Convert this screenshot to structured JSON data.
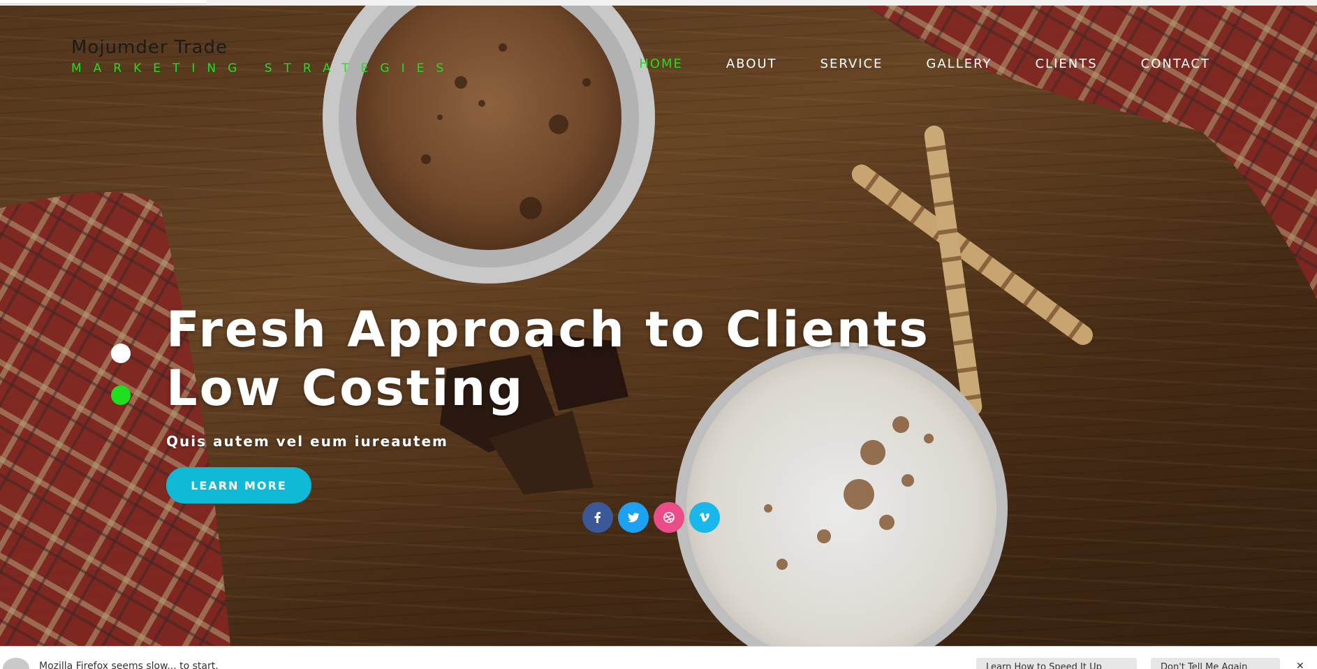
{
  "brand": {
    "name": "Mojumder Trade",
    "tagline": "MARKETING STRATEGIES"
  },
  "nav": {
    "items": [
      {
        "label": "HOME",
        "active": true
      },
      {
        "label": "ABOUT",
        "active": false
      },
      {
        "label": "SERVICE",
        "active": false
      },
      {
        "label": "GALLERY",
        "active": false
      },
      {
        "label": "CLIENTS",
        "active": false
      },
      {
        "label": "CONTACT",
        "active": false
      }
    ]
  },
  "hero": {
    "headline_1": "Fresh Approach to Clients",
    "headline_2": "Low Costing",
    "subheadline": "Quis autem vel eum iureautem",
    "cta_label": "LEARN MORE",
    "slides": [
      {
        "state": "inactive",
        "color": "#ffffff"
      },
      {
        "state": "active",
        "color": "#1ee01e"
      }
    ]
  },
  "social": [
    {
      "icon": "facebook-icon",
      "color": "#3b5998"
    },
    {
      "icon": "twitter-icon",
      "color": "#1da1f2"
    },
    {
      "icon": "dribbble-icon",
      "color": "#ea4c89"
    },
    {
      "icon": "vimeo-icon",
      "color": "#1ab7ea"
    }
  ],
  "notification_bar": {
    "message": "Mozilla Firefox seems slow... to start.",
    "button_1": "Learn How to Speed It Up",
    "button_2": "Don't Tell Me Again",
    "overflow": "✕"
  },
  "colors": {
    "accent_green": "#22dd22",
    "cta_blue": "#10b9d6"
  }
}
